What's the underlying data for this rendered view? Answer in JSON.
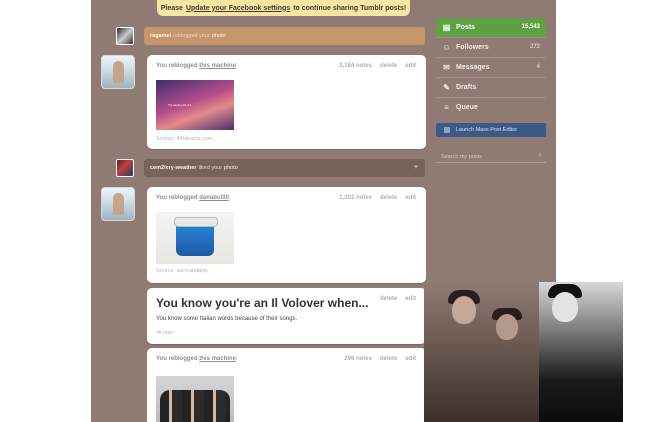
{
  "banner": {
    "pre": "Please",
    "link": "Update your Facebook settings",
    "post": "to continue sharing Tumblr posts!"
  },
  "notifications": [
    {
      "user": "ragamel",
      "action": "reblogged your",
      "object": "photo"
    },
    {
      "user": "cem2lery-weather",
      "action": "liked your",
      "object": "photo"
    }
  ],
  "posts": [
    {
      "header_pre": "You reblogged",
      "source_blog": "this machine",
      "notes": "2,164 notes",
      "delete_label": "delete",
      "edit_label": "edit",
      "image_text": "Try saying all of it",
      "source_line": "Source: 44ideams.com"
    },
    {
      "header_pre": "You reblogged",
      "source_blog": "danabulllll",
      "notes": "1,202 notes",
      "delete_label": "delete",
      "edit_label": "edit",
      "source_line": "Source: aserrandipity"
    },
    {
      "title": "You know you're an Il Volover when...",
      "body": "You know some Italian words because of their songs.",
      "tag": "#il volo",
      "delete_label": "delete",
      "edit_label": "edit"
    },
    {
      "header_pre": "You reblogged",
      "source_blog": "this machine",
      "notes": "296 notes",
      "delete_label": "delete",
      "edit_label": "edit"
    }
  ],
  "sidebar": {
    "items": [
      {
        "label": "Posts",
        "count": "15,543",
        "icon": "document-icon"
      },
      {
        "label": "Followers",
        "count": "272",
        "icon": "people-icon"
      },
      {
        "label": "Messages",
        "count": "4",
        "icon": "mail-icon"
      },
      {
        "label": "Drafts",
        "count": "",
        "icon": "draft-icon"
      },
      {
        "label": "Queue",
        "count": "",
        "icon": "queue-icon"
      }
    ],
    "mass_editor": "Launch Mass Post Editor",
    "search_placeholder": "Search my posts"
  },
  "colors": {
    "page_bg": "#8f7b73",
    "posts_active": "#5fa044",
    "mass_editor": "#3d5a86",
    "banner": "#f7e6a0"
  }
}
